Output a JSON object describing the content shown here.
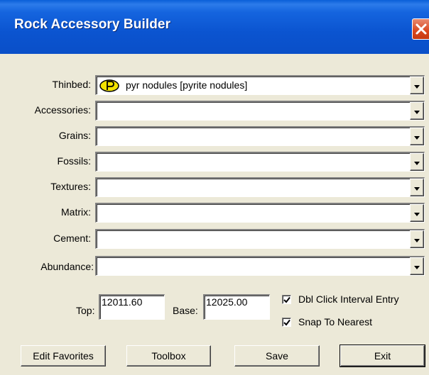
{
  "window": {
    "title": "Rock Accessory Builder"
  },
  "fields": [
    {
      "label": "Thinbed:",
      "value": "pyr nodules [pyrite nodules]",
      "icon": "pyrite-nodule-symbol-icon"
    },
    {
      "label": "Accessories:",
      "value": ""
    },
    {
      "label": "Grains:",
      "value": ""
    },
    {
      "label": "Fossils:",
      "value": ""
    },
    {
      "label": "Textures:",
      "value": ""
    },
    {
      "label": "Matrix:",
      "value": ""
    },
    {
      "label": "Cement:",
      "value": ""
    },
    {
      "label": "Abundance:",
      "value": ""
    }
  ],
  "interval": {
    "top_label": "Top:",
    "top_value": "12011.60",
    "base_label": "Base:",
    "base_value": "12025.00"
  },
  "options": {
    "dbl_click_label": "Dbl Click Interval Entry",
    "dbl_click_checked": true,
    "snap_label": "Snap To Nearest",
    "snap_checked": true
  },
  "buttons": {
    "edit_favorites": "Edit Favorites",
    "toolbox": "Toolbox",
    "save": "Save",
    "exit": "Exit"
  },
  "colors": {
    "titlebar": "#0B54D0",
    "dialog_bg": "#ECE9D8",
    "close_button": "#D9471F",
    "pyrite_icon": "#F2E200"
  }
}
